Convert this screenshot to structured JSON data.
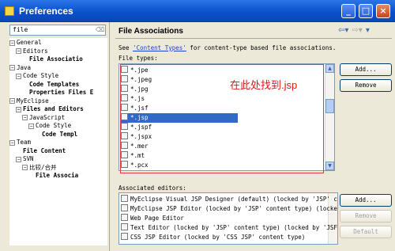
{
  "window": {
    "title": "Preferences"
  },
  "filter": {
    "value": "file"
  },
  "tree": [
    {
      "label": "General",
      "expander": "−",
      "bold": false
    },
    {
      "label": "Editors",
      "expander": "−",
      "bold": false
    },
    {
      "label": "File Associatio",
      "expander": "",
      "bold": true
    },
    {
      "label": "Java",
      "expander": "−",
      "bold": false
    },
    {
      "label": "Code Style",
      "expander": "−",
      "bold": false
    },
    {
      "label": "Code Templates",
      "expander": "",
      "bold": true
    },
    {
      "label": "Properties Files E",
      "expander": "",
      "bold": true
    },
    {
      "label": "MyEclipse",
      "expander": "−",
      "bold": false
    },
    {
      "label": "Files and Editors",
      "expander": "−",
      "bold": true
    },
    {
      "label": "JavaScript",
      "expander": "−",
      "bold": false
    },
    {
      "label": "Code Style",
      "expander": "−",
      "bold": false
    },
    {
      "label": "Code Templ",
      "expander": "",
      "bold": true
    },
    {
      "label": "Team",
      "expander": "−",
      "bold": false
    },
    {
      "label": "File Content",
      "expander": "",
      "bold": true
    },
    {
      "label": "SVN",
      "expander": "−",
      "bold": false
    },
    {
      "label": "比较/合并",
      "expander": "−",
      "bold": false
    },
    {
      "label": "File Associa",
      "expander": "",
      "bold": true
    }
  ],
  "page": {
    "title": "File Associations",
    "desc_prefix": "See ",
    "desc_link": "'Content Types'",
    "desc_suffix": " for content-type based file associations.",
    "file_types_label": "File types:",
    "associated_editors_label": "Associated editors:",
    "annotation": "在此处找到.jsp"
  },
  "file_types": [
    "*.jpe",
    "*.jpeg",
    "*.jpg",
    "*.js",
    "*.jsf",
    "*.jsp",
    "*.jspf",
    "*.jspx",
    "*.mer",
    "*.mt",
    "*.pcx"
  ],
  "selected_file_type": "*.jsp",
  "buttons": {
    "add_type": "Add...",
    "remove_type": "Remove",
    "add_editor": "Add...",
    "remove_editor": "Remove",
    "default_editor": "Default"
  },
  "editors": [
    "MyEclipse Visual JSP Designer (default) (locked by 'JSP' co",
    "MyEclipse JSP Editor (locked by 'JSP' content type) (locked",
    "Web Page Editor",
    "Text Editor (locked by 'JSP' content type) (locked by 'JSF E",
    "CSS JSP Editor (locked by 'CSS JSP' content type)"
  ],
  "colors": {
    "selection": "#316ac5",
    "annotation": "#e01818",
    "titlebar": "#0a4fc9"
  }
}
